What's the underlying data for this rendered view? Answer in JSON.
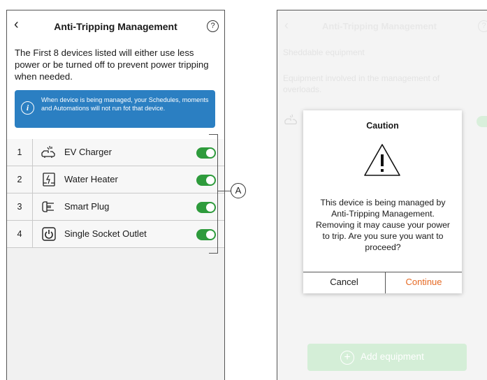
{
  "left": {
    "title": "Anti-Tripping Management",
    "back_icon": "chevron-left-icon",
    "help_icon": "help-circle-icon",
    "description": "The First 8 devices listed will either use less power or be turned off to prevent power tripping when needed.",
    "info_icon": "info-circle-icon",
    "info_text": "When device is being managed, your Schedules, moments and Automations will not run fot that device.",
    "devices": [
      {
        "num": "1",
        "name": "EV Charger",
        "icon": "ev-charger-icon",
        "enabled": true
      },
      {
        "num": "2",
        "name": "Water Heater",
        "icon": "water-heater-icon",
        "enabled": true
      },
      {
        "num": "3",
        "name": "Smart Plug",
        "icon": "smart-plug-icon",
        "enabled": true
      },
      {
        "num": "4",
        "name": "Single Socket Outlet",
        "icon": "socket-outlet-icon",
        "enabled": true
      }
    ],
    "callout_label": "A",
    "toggle_color": "#2e9b3c",
    "info_color": "#2b7fc2"
  },
  "right": {
    "bg_title": "Anti-Tripping Management",
    "bg_line1": "Sheddable equipment",
    "bg_line2": "Equipment involved in the management of overloads.",
    "add_button": "Add equipment",
    "dialog": {
      "title": "Caution",
      "icon": "warning-triangle-icon",
      "message": "This device is being managed by Anti-Tripping Management. Removing it may cause your power to trip. Are you sure you want to proceed?",
      "cancel": "Cancel",
      "continue": "Continue"
    },
    "continue_color": "#e66a24"
  }
}
